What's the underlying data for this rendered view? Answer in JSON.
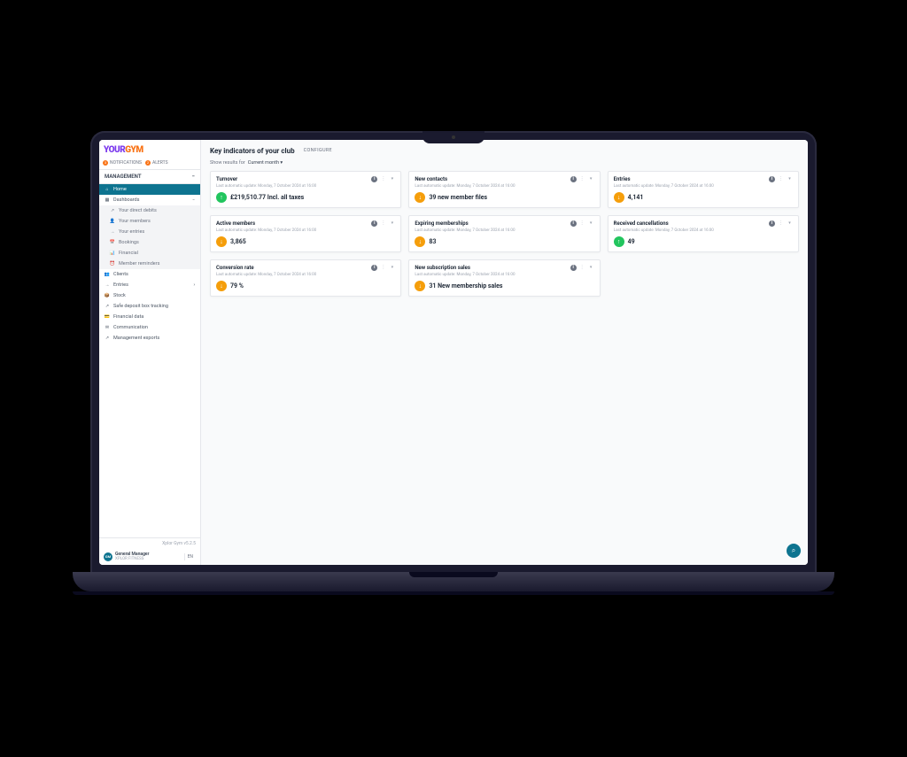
{
  "logo": {
    "part1": "YOUR",
    "part2": "GYM"
  },
  "header_notifs": {
    "notifications": {
      "label": "NOTIFICATIONS",
      "badge": "3"
    },
    "alerts": {
      "label": "ALERTS",
      "badge": "2"
    }
  },
  "sidebar": {
    "section": "MANAGEMENT",
    "items": [
      {
        "icon": "⌂",
        "label": "Home",
        "active": true
      },
      {
        "icon": "▦",
        "label": "Dashboards",
        "expandable": true
      },
      {
        "icon": "↗",
        "label": "Your direct debits",
        "sub": true
      },
      {
        "icon": "👤",
        "label": "Your members",
        "sub": true
      },
      {
        "icon": "→",
        "label": "Your entries",
        "sub": true
      },
      {
        "icon": "📅",
        "label": "Bookings",
        "sub": true
      },
      {
        "icon": "📊",
        "label": "Financial",
        "sub": true
      },
      {
        "icon": "⏰",
        "label": "Member reminders",
        "sub": true
      },
      {
        "icon": "👥",
        "label": "Clients"
      },
      {
        "icon": "→",
        "label": "Entries",
        "expandable": true
      },
      {
        "icon": "📦",
        "label": "Stock"
      },
      {
        "icon": "↗",
        "label": "Safe deposit box tracking"
      },
      {
        "icon": "💳",
        "label": "Financial data"
      },
      {
        "icon": "✉",
        "label": "Communication"
      },
      {
        "icon": "↗",
        "label": "Management exports"
      }
    ],
    "version": "Xplor Gym v5.2.5",
    "user": {
      "initials": "GM",
      "name": "General Manager",
      "org": "XPLOR FITNESS",
      "lang": "EN"
    }
  },
  "main": {
    "title": "Key indicators of your club",
    "configure": "CONFIGURE",
    "filter_label": "Show results for",
    "filter_value": "Current month",
    "update_text": "Last automatic update: Monday, 7 October 2024 at 16:00",
    "cards": [
      {
        "title": "Turnover",
        "value": "£219,510.77 Incl. all taxes",
        "trend": "up"
      },
      {
        "title": "New contacts",
        "value": "39 new member files",
        "trend": "down"
      },
      {
        "title": "Entries",
        "value": "4,141",
        "trend": "down"
      },
      {
        "title": "Active members",
        "value": "3,865",
        "trend": "down"
      },
      {
        "title": "Expiring memberships",
        "value": "83",
        "trend": "down"
      },
      {
        "title": "Received cancellations",
        "value": "49",
        "trend": "up"
      },
      {
        "title": "Conversion rate",
        "value": "79 %",
        "trend": "down"
      },
      {
        "title": "New subscription sales",
        "value": "31 New membership sales",
        "trend": "down"
      }
    ]
  }
}
